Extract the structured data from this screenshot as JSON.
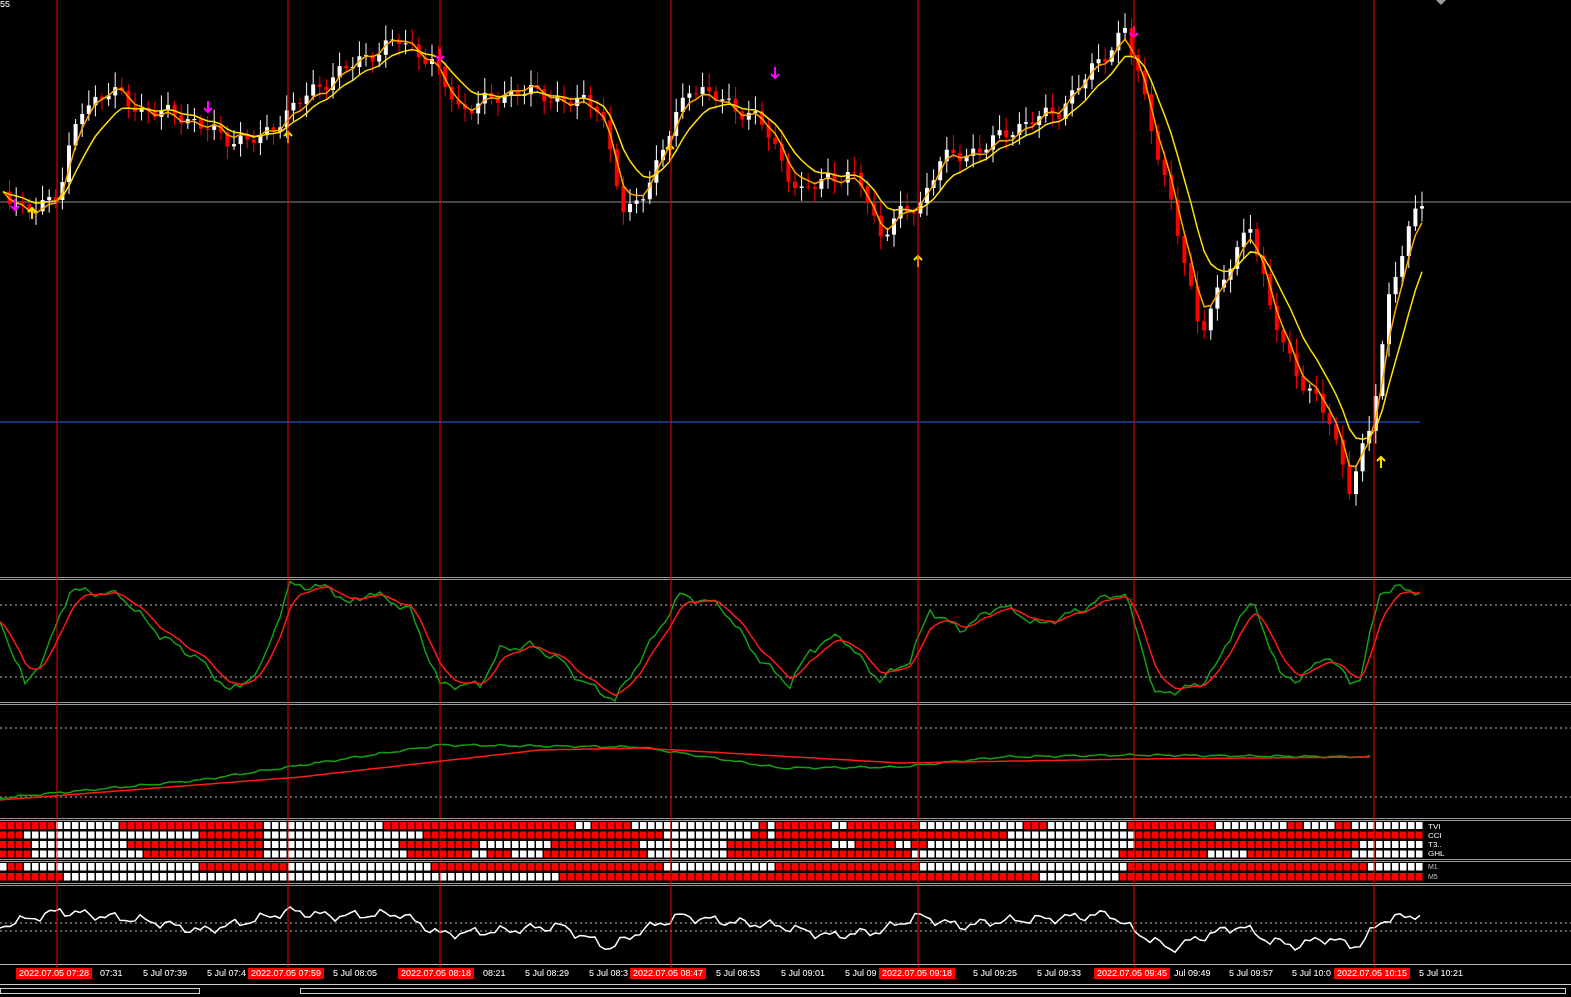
{
  "corner_price": "55",
  "signal_labels": [
    "TVI",
    "CCI",
    "T3..",
    "GHL"
  ],
  "timeframe_labels": [
    "M1",
    "M5"
  ],
  "time_axis": [
    {
      "text": "2022.07.05 07:28",
      "kind": "highlight"
    },
    {
      "text": "07:31",
      "kind": "tick"
    },
    {
      "text": "5 Jul 07:39",
      "kind": "tick"
    },
    {
      "text": "5 Jul 07:4",
      "kind": "tick"
    },
    {
      "text": "2022.07.05 07:59",
      "kind": "highlight"
    },
    {
      "text": "5 Jul 08:05",
      "kind": "tick"
    },
    {
      "text": "2022.07.05 08:18",
      "kind": "highlight"
    },
    {
      "text": "08:21",
      "kind": "tick"
    },
    {
      "text": "5 Jul 08:29",
      "kind": "tick"
    },
    {
      "text": "5 Jul 08:3",
      "kind": "tick"
    },
    {
      "text": "2022.07.05 08:47",
      "kind": "highlight"
    },
    {
      "text": "5 Jul 08:53",
      "kind": "tick"
    },
    {
      "text": "5 Jul 09:01",
      "kind": "tick"
    },
    {
      "text": "5 Jul 09",
      "kind": "tick"
    },
    {
      "text": "2022.07.05 09:18",
      "kind": "highlight"
    },
    {
      "text": "5 Jul 09:25",
      "kind": "tick"
    },
    {
      "text": "5 Jul 09:33",
      "kind": "tick"
    },
    {
      "text": "2022.07.05 09:45",
      "kind": "highlight"
    },
    {
      "text": "Jul 09:49",
      "kind": "tick"
    },
    {
      "text": "5 Jul 09:57",
      "kind": "tick"
    },
    {
      "text": "5 Jul 10:0",
      "kind": "tick"
    },
    {
      "text": "2022.07.05 10:15",
      "kind": "highlight"
    },
    {
      "text": "5 Jul 10:21",
      "kind": "tick"
    }
  ]
}
